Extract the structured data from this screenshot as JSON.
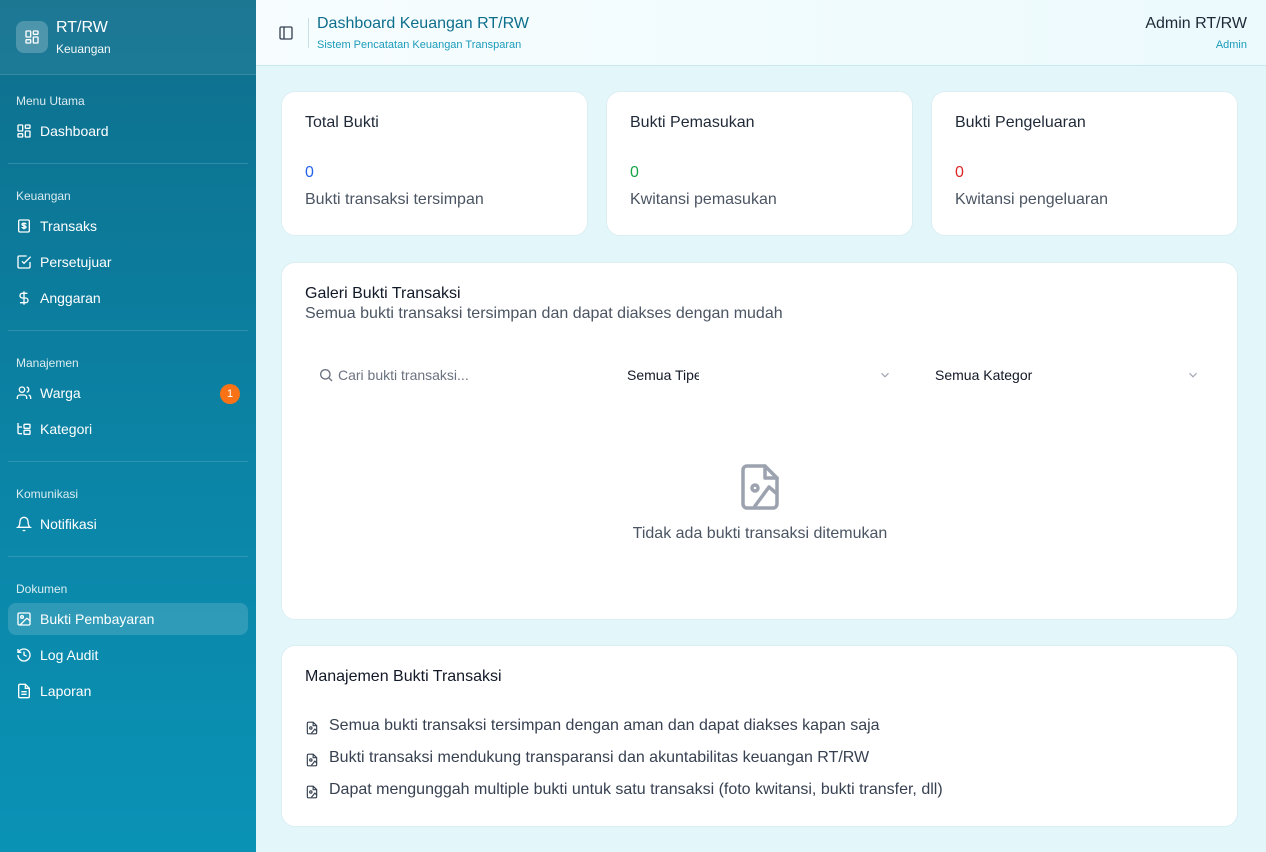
{
  "brand": {
    "title": "RT/RW",
    "subtitle": "Keuangan",
    "icon": "layout-grid-icon"
  },
  "sidebar": {
    "groups": [
      {
        "label": "Menu Utama",
        "items": [
          {
            "label": "Dashboard",
            "icon": "layout-grid-icon"
          }
        ]
      },
      {
        "label": "Keuangan",
        "items": [
          {
            "label": "Transaks",
            "icon": "receipt-icon"
          },
          {
            "label": "Persetujuar",
            "icon": "check-square-icon"
          },
          {
            "label": "Anggaran",
            "icon": "dollar-icon"
          }
        ]
      },
      {
        "label": "Manajemen",
        "items": [
          {
            "label": "Warga",
            "icon": "users-icon",
            "badge": "1"
          },
          {
            "label": "Kategori",
            "icon": "folder-tree-icon"
          }
        ]
      },
      {
        "label": "Komunikasi",
        "items": [
          {
            "label": "Notifikasi",
            "icon": "bell-icon"
          }
        ]
      },
      {
        "label": "Dokumen",
        "items": [
          {
            "label": "Bukti Pembayaran",
            "icon": "image-icon",
            "active": true
          },
          {
            "label": "Log Audit",
            "icon": "history-icon"
          },
          {
            "label": "Laporan",
            "icon": "file-text-icon"
          }
        ]
      }
    ]
  },
  "header": {
    "title": "Dashboard Keuangan RT/RW",
    "subtitle": "Sistem Pencatatan Keuangan Transparan",
    "user_name": "Admin RT/RW",
    "user_role": "Admin"
  },
  "stats": [
    {
      "title": "Total Bukti",
      "value": "0",
      "desc": "Bukti transaksi tersimpan",
      "color": "#2563eb"
    },
    {
      "title": "Bukti Pemasukan",
      "value": "0",
      "desc": "Kwitansi pemasukan",
      "color": "#16a34a"
    },
    {
      "title": "Bukti Pengeluaran",
      "value": "0",
      "desc": "Kwitansi pengeluaran",
      "color": "#dc2626"
    }
  ],
  "gallery": {
    "title": "Galeri Bukti Transaksi",
    "subtitle": "Semua bukti transaksi tersimpan dan dapat diakses dengan mudah",
    "search_placeholder": "Cari bukti transaksi...",
    "type_select": "Semua Tipe",
    "category_select": "Semua Kategor",
    "empty_text": "Tidak ada bukti transaksi ditemukan"
  },
  "management": {
    "title": "Manajemen Bukti Transaksi",
    "items": [
      "Semua bukti transaksi tersimpan dengan aman dan dapat diakses kapan saja",
      "Bukti transaksi mendukung transparansi dan akuntabilitas keuangan RT/RW",
      "Dapat mengunggah multiple bukti untuk satu transaksi (foto kwitansi, bukti transfer, dll)"
    ]
  },
  "colors": {
    "sidebar_start": "#0e6f8d",
    "sidebar_end": "#0a92b5",
    "accent": "#0e6f8d",
    "badge": "#f97316"
  }
}
